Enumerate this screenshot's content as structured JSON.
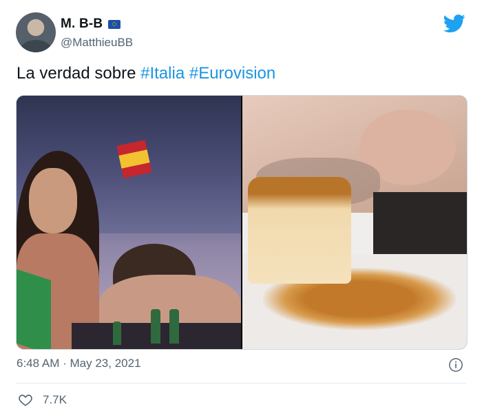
{
  "author": {
    "display_name": "M. B-B",
    "handle": "@MatthieuBB",
    "badge_icon": "eu-flag-icon"
  },
  "brand": {
    "icon": "twitter-bird-icon",
    "color": "#1da1f2"
  },
  "tweet": {
    "text_before": "La verdad sobre ",
    "hashtags": [
      "#Italia",
      "#Eurovision"
    ],
    "hashtag_color": "#1b95e0"
  },
  "media": {
    "count": 2,
    "items": [
      {
        "name": "eurovision-stage-photo"
      },
      {
        "name": "flan-licking-photo"
      }
    ]
  },
  "meta": {
    "time": "6:48 AM",
    "separator": "·",
    "date": "May 23, 2021",
    "info_icon": "info-icon"
  },
  "engagement": {
    "like_icon": "heart-icon",
    "likes": "7.7K"
  }
}
